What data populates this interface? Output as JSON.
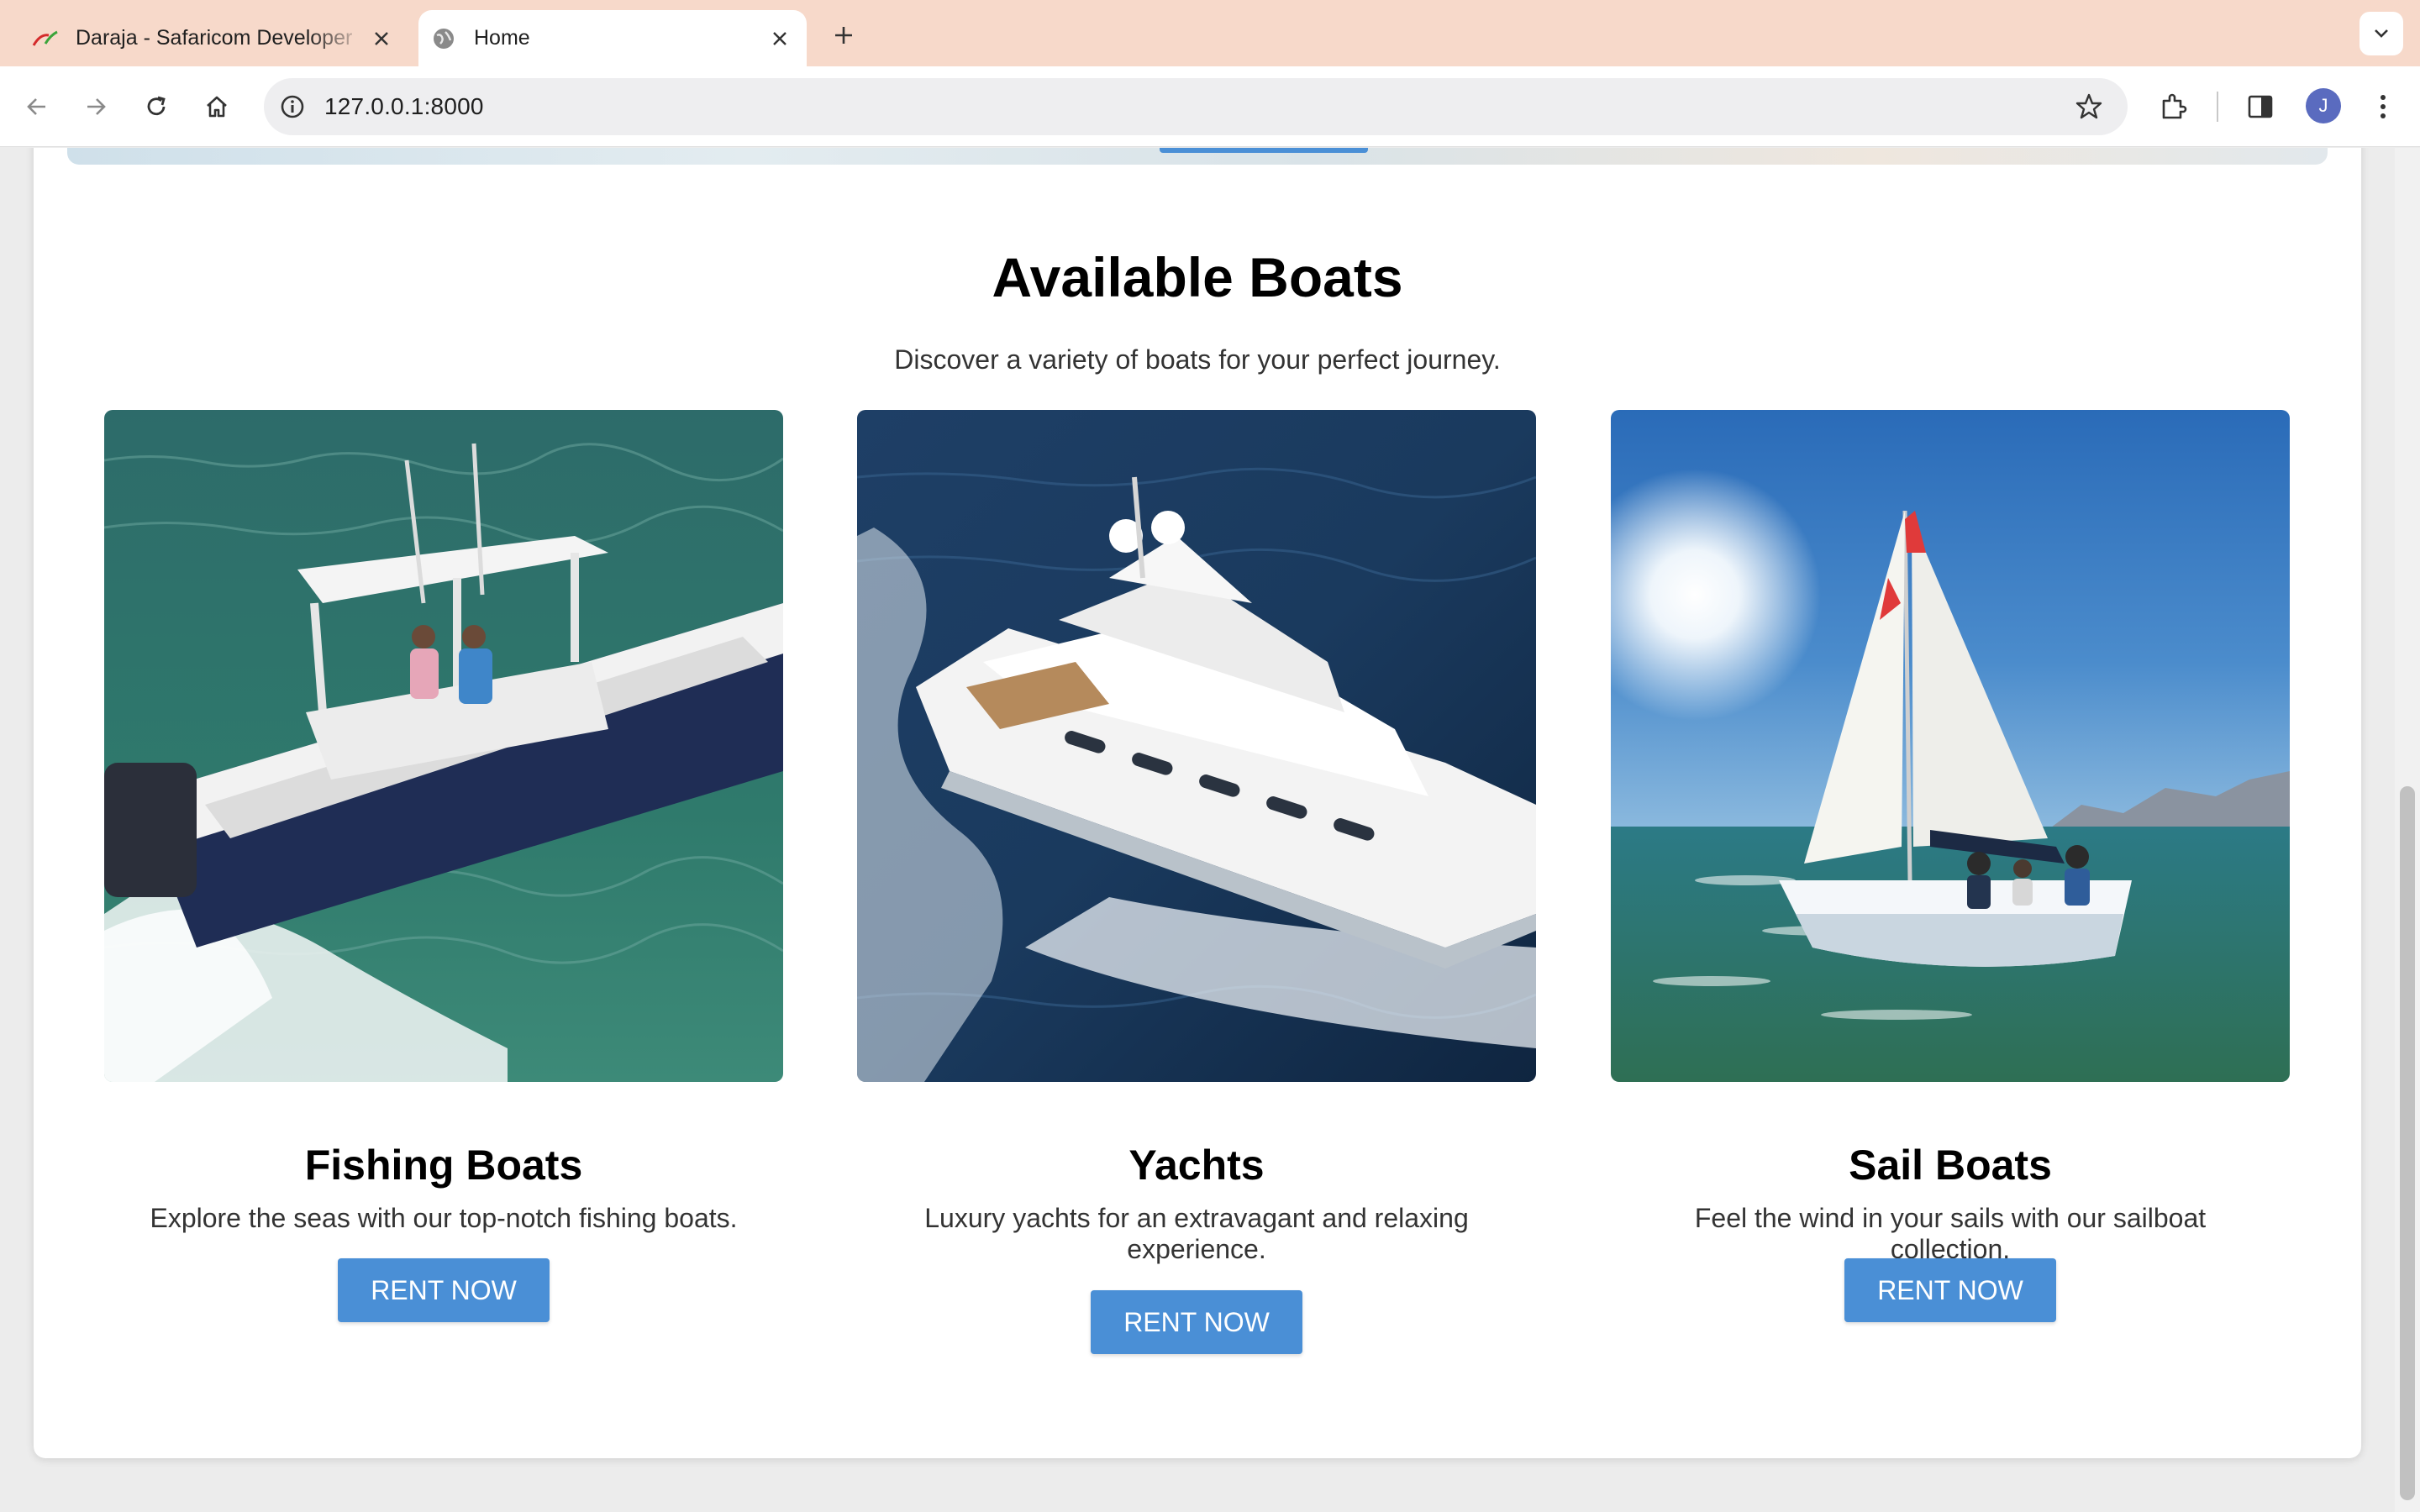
{
  "browser": {
    "tabs": [
      {
        "title": "Daraja - Safaricom Developer",
        "active": false
      },
      {
        "title": "Home",
        "active": true
      }
    ],
    "url": "127.0.0.1:8000",
    "profile_initial": "J"
  },
  "section": {
    "title": "Available Boats",
    "subtitle": "Discover a variety of boats for your perfect journey."
  },
  "boats": [
    {
      "name": "Fishing Boats",
      "description": "Explore the seas with our top-notch fishing boats.",
      "button": "RENT NOW"
    },
    {
      "name": "Yachts",
      "description": "Luxury yachts for an extravagant and relaxing experience.",
      "button": "RENT NOW"
    },
    {
      "name": "Sail Boats",
      "description": "Feel the wind in your sails with our sailboat collection.",
      "button": "RENT NOW"
    }
  ],
  "colors": {
    "tabstrip": "#f7d9ca",
    "accent_button": "#4a8fd6",
    "avatar": "#5a6bbf"
  },
  "icons": [
    "safaricom-favicon",
    "globe-icon",
    "close-icon",
    "plus-icon",
    "chevron-down-icon",
    "back-icon",
    "forward-icon",
    "reload-icon",
    "home-icon",
    "info-icon",
    "star-icon",
    "extensions-icon",
    "side-panel-icon",
    "kebab-menu-icon"
  ]
}
